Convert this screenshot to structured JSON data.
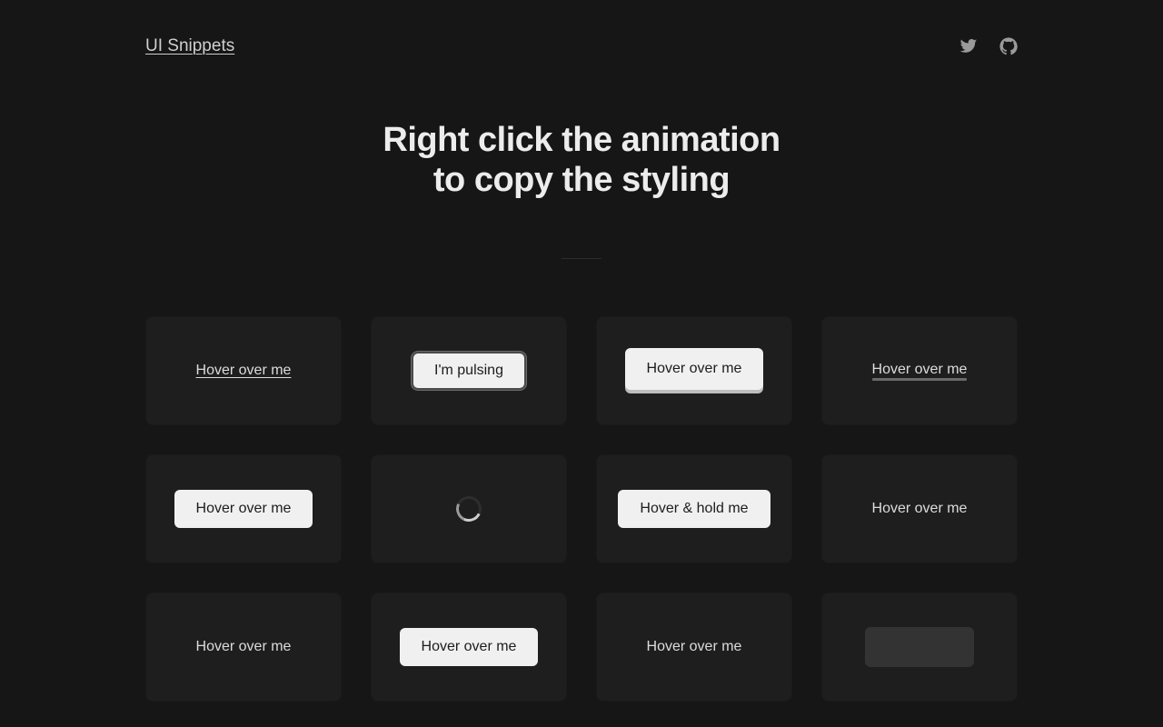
{
  "header": {
    "logo": "UI Snippets",
    "social": [
      {
        "name": "twitter",
        "icon": "twitter-icon"
      },
      {
        "name": "github",
        "icon": "github-icon"
      }
    ]
  },
  "hero": {
    "line1": "Right click the animation",
    "line2": "to copy the styling"
  },
  "cards": [
    {
      "label": "Hover over me",
      "style": "text-underline"
    },
    {
      "label": "I'm pulsing",
      "style": "light-pulse"
    },
    {
      "label": "Hover over me",
      "style": "light-3d"
    },
    {
      "label": "Hover over me",
      "style": "text-bar-underline"
    },
    {
      "label": "Hover over me",
      "style": "light"
    },
    {
      "label": "",
      "style": "spinner"
    },
    {
      "label": "Hover & hold me",
      "style": "light"
    },
    {
      "label": "Hover over me",
      "style": "text"
    },
    {
      "label": "Hover over me",
      "style": "text"
    },
    {
      "label": "Hover over me",
      "style": "light"
    },
    {
      "label": "Hover over me",
      "style": "text"
    },
    {
      "label": "",
      "style": "skeleton"
    }
  ],
  "colors": {
    "background": "#161616",
    "card": "#1e1e1e",
    "button_light": "#f0f0f0",
    "text": "#dcdcdc"
  }
}
